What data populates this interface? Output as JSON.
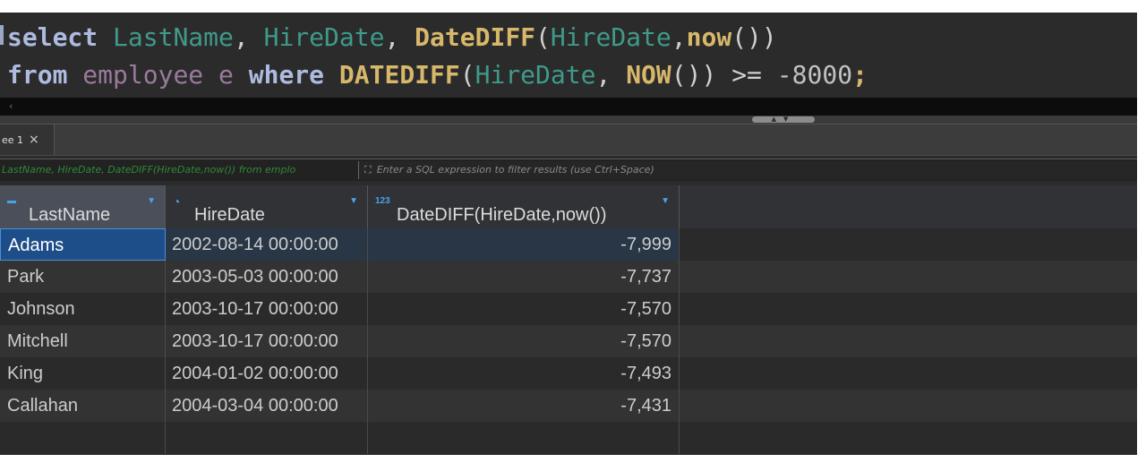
{
  "editor": {
    "line1": [
      {
        "t": "select ",
        "c": "kw"
      },
      {
        "t": "LastName",
        "c": "col"
      },
      {
        "t": ", ",
        "c": "pn"
      },
      {
        "t": "HireDate",
        "c": "col"
      },
      {
        "t": ", ",
        "c": "pn"
      },
      {
        "t": "DateDIFF",
        "c": "fn"
      },
      {
        "t": "(",
        "c": "pn"
      },
      {
        "t": "HireDate",
        "c": "col"
      },
      {
        "t": ",",
        "c": "pn"
      },
      {
        "t": "now",
        "c": "fn"
      },
      {
        "t": "())",
        "c": "pn"
      }
    ],
    "line2": [
      {
        "t": "from ",
        "c": "kw"
      },
      {
        "t": "employee ",
        "c": "tbl"
      },
      {
        "t": "e ",
        "c": "tbl"
      },
      {
        "t": "where ",
        "c": "kw"
      },
      {
        "t": "DATEDIFF",
        "c": "fn"
      },
      {
        "t": "(",
        "c": "pn"
      },
      {
        "t": "HireDate",
        "c": "col"
      },
      {
        "t": ", ",
        "c": "pn"
      },
      {
        "t": "NOW",
        "c": "fn"
      },
      {
        "t": "()) >= ",
        "c": "pn"
      },
      {
        "t": "-8000",
        "c": "num"
      },
      {
        "t": ";",
        "c": "fn"
      }
    ]
  },
  "scroll": {
    "left_arrow": "‹"
  },
  "result_tab": {
    "label": "ee 1",
    "close": "×"
  },
  "filter": {
    "sql_text": "LastName, HireDate, DateDIFF(HireDate,now()) from emplo",
    "placeholder": "Enter a SQL expression to filter results (use Ctrl+Space)",
    "icon": "filter-icon"
  },
  "grid": {
    "columns": [
      {
        "label": "LastName",
        "type_icon": "abc"
      },
      {
        "label": "HireDate",
        "type_icon": "clock"
      },
      {
        "label": "DateDIFF(HireDate,now())",
        "type_icon": "123"
      }
    ],
    "rows": [
      {
        "LastName": "Adams",
        "HireDate": "2002-08-14 00:00:00",
        "DateDIFF": "-7,999"
      },
      {
        "LastName": "Park",
        "HireDate": "2003-05-03 00:00:00",
        "DateDIFF": "-7,737"
      },
      {
        "LastName": "Johnson",
        "HireDate": "2003-10-17 00:00:00",
        "DateDIFF": "-7,570"
      },
      {
        "LastName": "Mitchell",
        "HireDate": "2003-10-17 00:00:00",
        "DateDIFF": "-7,570"
      },
      {
        "LastName": "King",
        "HireDate": "2004-01-02 00:00:00",
        "DateDIFF": "-7,493"
      },
      {
        "LastName": "Callahan",
        "HireDate": "2004-03-04 00:00:00",
        "DateDIFF": "-7,431"
      }
    ],
    "selected_row": 0
  },
  "colors": {
    "keyword": "#aebbe0",
    "function": "#d7b86b",
    "column": "#3f9a8b",
    "table": "#9a7a9c",
    "selection": "#1e4e8a",
    "accent": "#4aa3e8"
  }
}
